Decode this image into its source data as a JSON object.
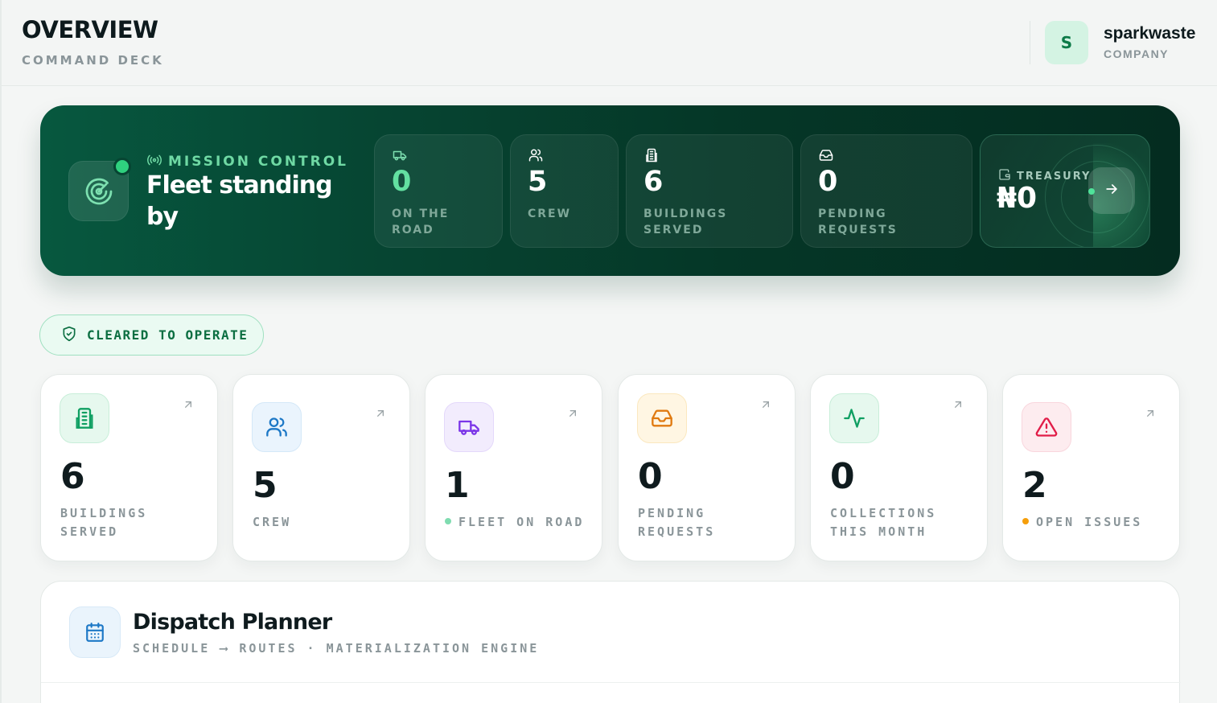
{
  "header": {
    "title": "OVERVIEW",
    "subtitle": "COMMAND DECK",
    "company": {
      "initial": "S",
      "name": "sparkwaste",
      "role": "COMPANY"
    }
  },
  "hero": {
    "kicker": "MISSION CONTROL",
    "title": "Fleet standing by",
    "stats": [
      {
        "value": "0",
        "label": "ON THE ROAD",
        "icon": "truck-icon"
      },
      {
        "value": "5",
        "label": "CREW",
        "icon": "users-icon"
      },
      {
        "value": "6",
        "label": "BUILDINGS SERVED",
        "icon": "building-icon"
      },
      {
        "value": "0",
        "label": "PENDING REQUESTS",
        "icon": "inbox-icon"
      }
    ],
    "treasury": {
      "label": "TREASURY",
      "value": "₦0",
      "icon": "wallet-icon"
    }
  },
  "status_badge": {
    "label": "CLEARED TO OPERATE",
    "icon": "shield-check-icon"
  },
  "cards": [
    {
      "value": "6",
      "label": "BUILDINGS SERVED",
      "icon": "building-icon",
      "color": "#0f9f62"
    },
    {
      "value": "5",
      "label": "CREW",
      "icon": "users-icon",
      "color": "#1d78c6"
    },
    {
      "value": "1",
      "label": "FLEET ON ROAD",
      "icon": "truck-icon",
      "color": "#7b35e8",
      "dot": "#34d399"
    },
    {
      "value": "0",
      "label": "PENDING REQUESTS",
      "icon": "inbox-icon",
      "color": "#e07a10"
    },
    {
      "value": "0",
      "label": "COLLECTIONS THIS MONTH",
      "icon": "activity-icon",
      "color": "#0f9f62"
    },
    {
      "value": "2",
      "label": "OPEN ISSUES",
      "icon": "alert-triangle-icon",
      "color": "#e11d48",
      "dot": "#f59e0b"
    }
  ],
  "planner": {
    "title": "Dispatch Planner",
    "subtitle": "SCHEDULE ⟶ ROUTES · MATERIALIZATION ENGINE",
    "icon": "calendar-icon"
  }
}
